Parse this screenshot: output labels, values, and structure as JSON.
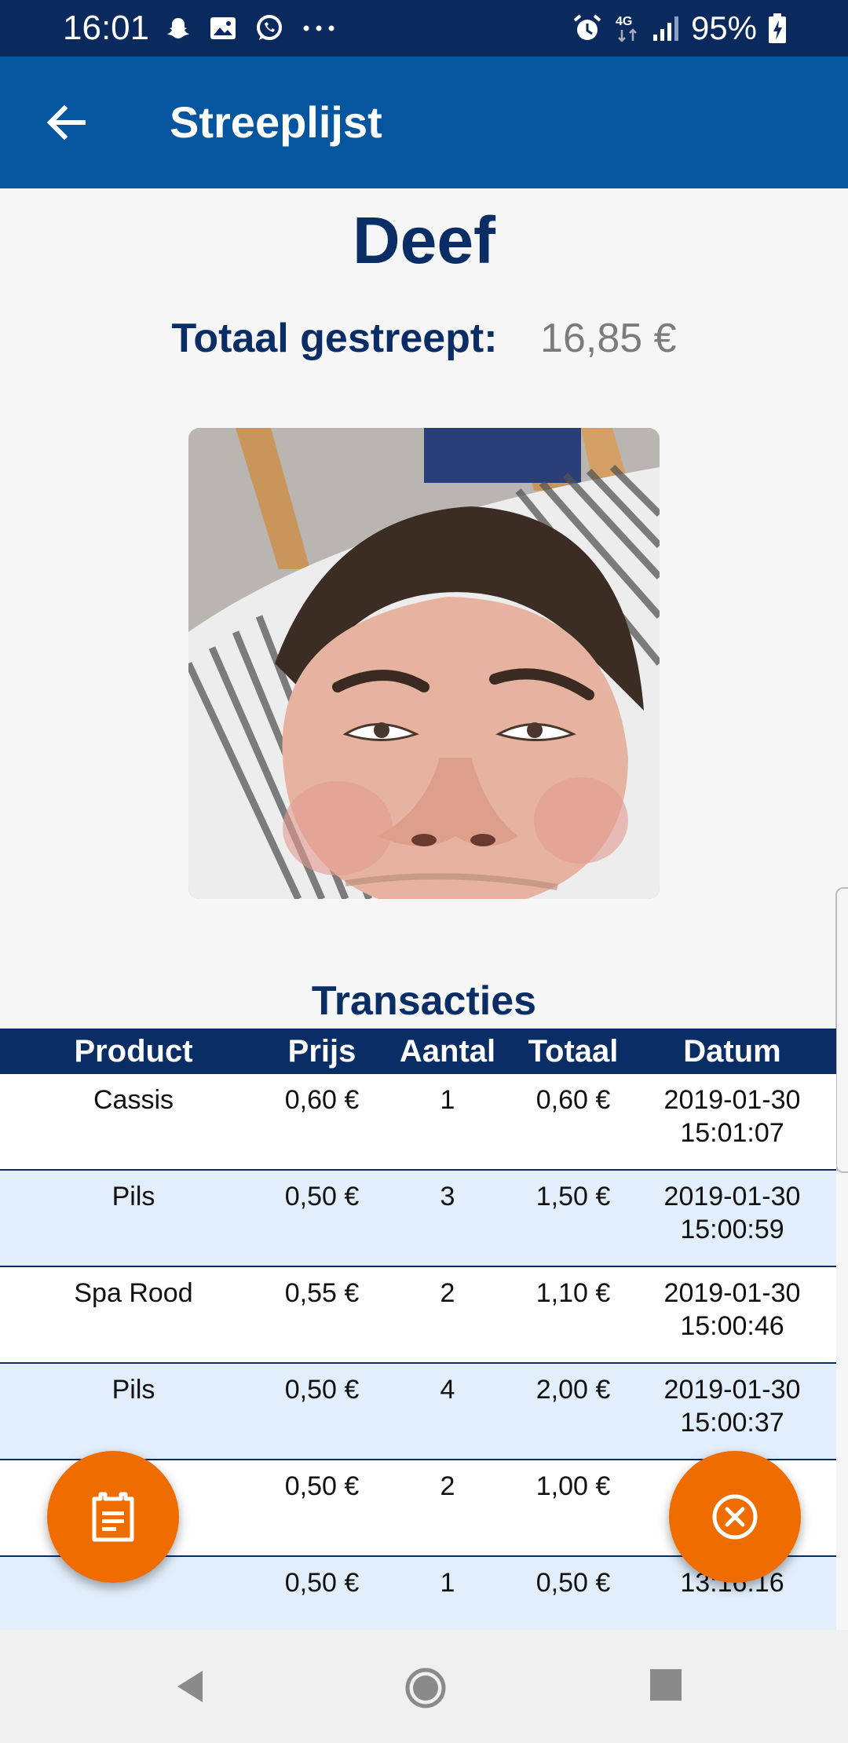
{
  "status_bar": {
    "time": "16:01",
    "battery": "95%",
    "network": "4G",
    "icons": [
      "snapchat-icon",
      "image-icon",
      "whatsapp-icon",
      "more-icon",
      "alarm-icon",
      "signal-icon",
      "battery-charging-icon"
    ]
  },
  "app_bar": {
    "title": "Streeplijst",
    "back_icon": "arrow-back-icon"
  },
  "profile": {
    "name": "Deef",
    "total_label": "Totaal gestreept:",
    "total_value": "16,85 €"
  },
  "transactions": {
    "title": "Transacties",
    "columns": [
      "Product",
      "Prijs",
      "Aantal",
      "Totaal",
      "Datum"
    ],
    "rows": [
      {
        "product": "Cassis",
        "price": "0,60 €",
        "amount": "1",
        "total": "0,60 €",
        "date": "2019-01-30",
        "time": "15:01:07"
      },
      {
        "product": "Pils",
        "price": "0,50 €",
        "amount": "3",
        "total": "1,50 €",
        "date": "2019-01-30",
        "time": "15:00:59"
      },
      {
        "product": "Spa Rood",
        "price": "0,55 €",
        "amount": "2",
        "total": "1,10 €",
        "date": "2019-01-30",
        "time": "15:00:46"
      },
      {
        "product": "Pils",
        "price": "0,50 €",
        "amount": "4",
        "total": "2,00 €",
        "date": "2019-01-30",
        "time": "15:00:37"
      },
      {
        "product": "",
        "price": "0,50 €",
        "amount": "2",
        "total": "1,00 €",
        "date": "",
        "time": ""
      },
      {
        "product": "",
        "price": "0,50 €",
        "amount": "1",
        "total": "0,50 €",
        "date": "",
        "time": "13:16:16"
      }
    ]
  },
  "fabs": {
    "left_icon": "receipt-icon",
    "right_icon": "cancel-circle-icon"
  },
  "colors": {
    "status_bar": "#0a2a5e",
    "app_bar": "#05559f",
    "primary_text": "#0b2d66",
    "accent": "#ef6c00",
    "row_alt": "#e2eefb"
  }
}
